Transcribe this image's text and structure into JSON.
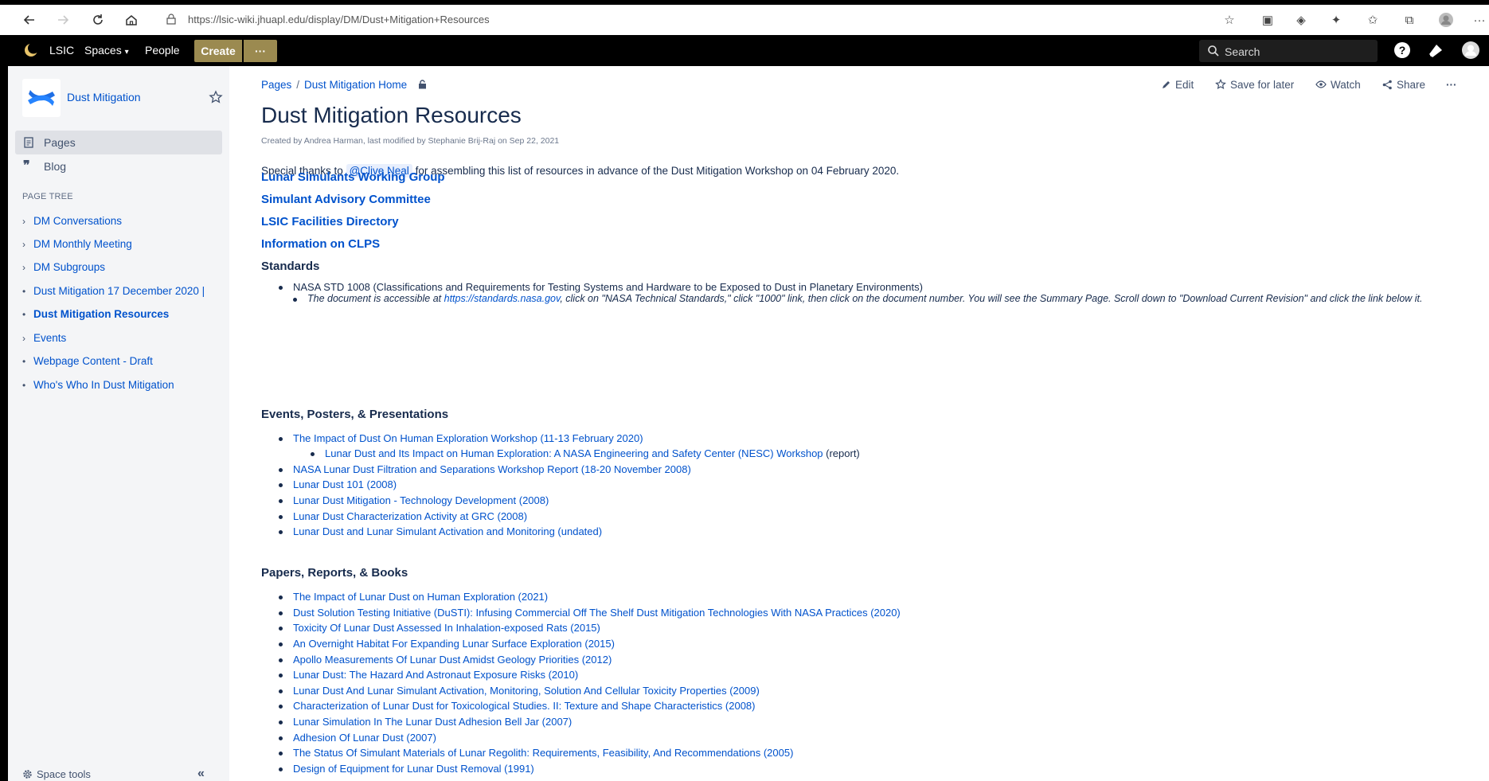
{
  "browser": {
    "url": "https://lsic-wiki.jhuapl.edu/display/DM/Dust+Mitigation+Resources"
  },
  "topnav": {
    "brand": "LSIC",
    "spaces": "Spaces",
    "people": "People",
    "create": "Create",
    "more": "···",
    "search_placeholder": "Search"
  },
  "sidebar": {
    "space_name": "Dust Mitigation",
    "pages_label": "Pages",
    "blog_label": "Blog",
    "page_tree_heading": "PAGE TREE",
    "tree": [
      {
        "mark": "›",
        "label": "DM Conversations"
      },
      {
        "mark": "›",
        "label": "DM Monthly Meeting"
      },
      {
        "mark": "›",
        "label": "DM Subgroups"
      },
      {
        "mark": "•",
        "label": "Dust Mitigation 17 December 2020 |"
      },
      {
        "mark": "•",
        "label": "Dust Mitigation Resources",
        "current": true
      },
      {
        "mark": "›",
        "label": "Events"
      },
      {
        "mark": "•",
        "label": "Webpage Content - Draft"
      },
      {
        "mark": "•",
        "label": "Who's Who In Dust Mitigation"
      }
    ],
    "space_tools": "Space tools",
    "collapse": "«"
  },
  "page": {
    "breadcrumb": [
      "Pages",
      "Dust Mitigation Home"
    ],
    "actions": {
      "edit": "Edit",
      "save_for_later": "Save for later",
      "watch": "Watch",
      "share": "Share",
      "more": "···"
    },
    "title": "Dust Mitigation Resources",
    "meta": "Created by Andrea Harman, last modified by Stephanie Brij-Raj on Sep 22, 2021",
    "thanks_before": "Special thanks to",
    "mention": "@Clive Neal",
    "thanks_after": "for assembling this list of resources in advance of the Dust Mitigation Workshop on 04 February 2020.",
    "top_links": [
      "Lunar Simulants Working Group",
      "Simulant Advisory Committee",
      "LSIC Facilities Directory",
      "Information on CLPS"
    ],
    "standards": {
      "heading": "Standards",
      "item": "NASA STD 1008 (Classifications and Requirements for Testing Systems and Hardware to be Exposed to Dust in Planetary Environments)",
      "note_before": "The document is accessible at ",
      "note_link": "https://standards.nasa.gov",
      "note_after": ", click on \"NASA Technical Standards,\" click \"1000\" link, then click on the document number. You will see the Summary Page. Scroll down to \"Download Current Revision\" and click the link below it."
    },
    "events": {
      "heading": "Events, Posters, & Presentations",
      "item1": "The Impact of Dust On Human Exploration Workshop (11-13 February 2020)",
      "sub_link": "Lunar Dust and Its Impact on Human Exploration: A NASA Engineering and Safety Center (NESC) Workshop",
      "sub_suffix": " (report)",
      "items": [
        "NASA Lunar Dust Filtration and Separations Workshop Report (18-20 November 2008)",
        "Lunar Dust 101 (2008)",
        "Lunar Dust Mitigation - Technology Development (2008)",
        "Lunar Dust Characterization Activity at GRC (2008)",
        "Lunar Dust and Lunar Simulant Activation and Monitoring (undated)"
      ]
    },
    "papers": {
      "heading": "Papers, Reports, & Books",
      "items": [
        "The Impact of Lunar Dust on Human Exploration (2021)",
        "Dust Solution Testing Initiative (DuSTI): Infusing Commercial Off The Shelf Dust Mitigation Technologies With NASA Practices (2020)",
        "Toxicity Of Lunar Dust Assessed In Inhalation-exposed Rats (2015)",
        "An Overnight Habitat For Expanding Lunar Surface Exploration (2015)",
        "Apollo Measurements Of Lunar Dust Amidst Geology Priorities (2012)",
        "Lunar Dust: The Hazard And Astronaut Exposure Risks (2010)",
        "Lunar Dust And Lunar Simulant Activation, Monitoring, Solution And Cellular Toxicity Properties (2009)",
        "Characterization of Lunar Dust for Toxicological Studies. II: Texture and Shape Characteristics (2008)",
        "Lunar Simulation In The Lunar Dust Adhesion Bell Jar (2007)",
        "Adhesion Of Lunar Dust (2007)",
        "The Status Of Simulant Materials of Lunar Regolith: Requirements, Feasibility, And Recommendations (2005)",
        "Design of Equipment for Lunar Dust Removal (1991)"
      ]
    }
  }
}
